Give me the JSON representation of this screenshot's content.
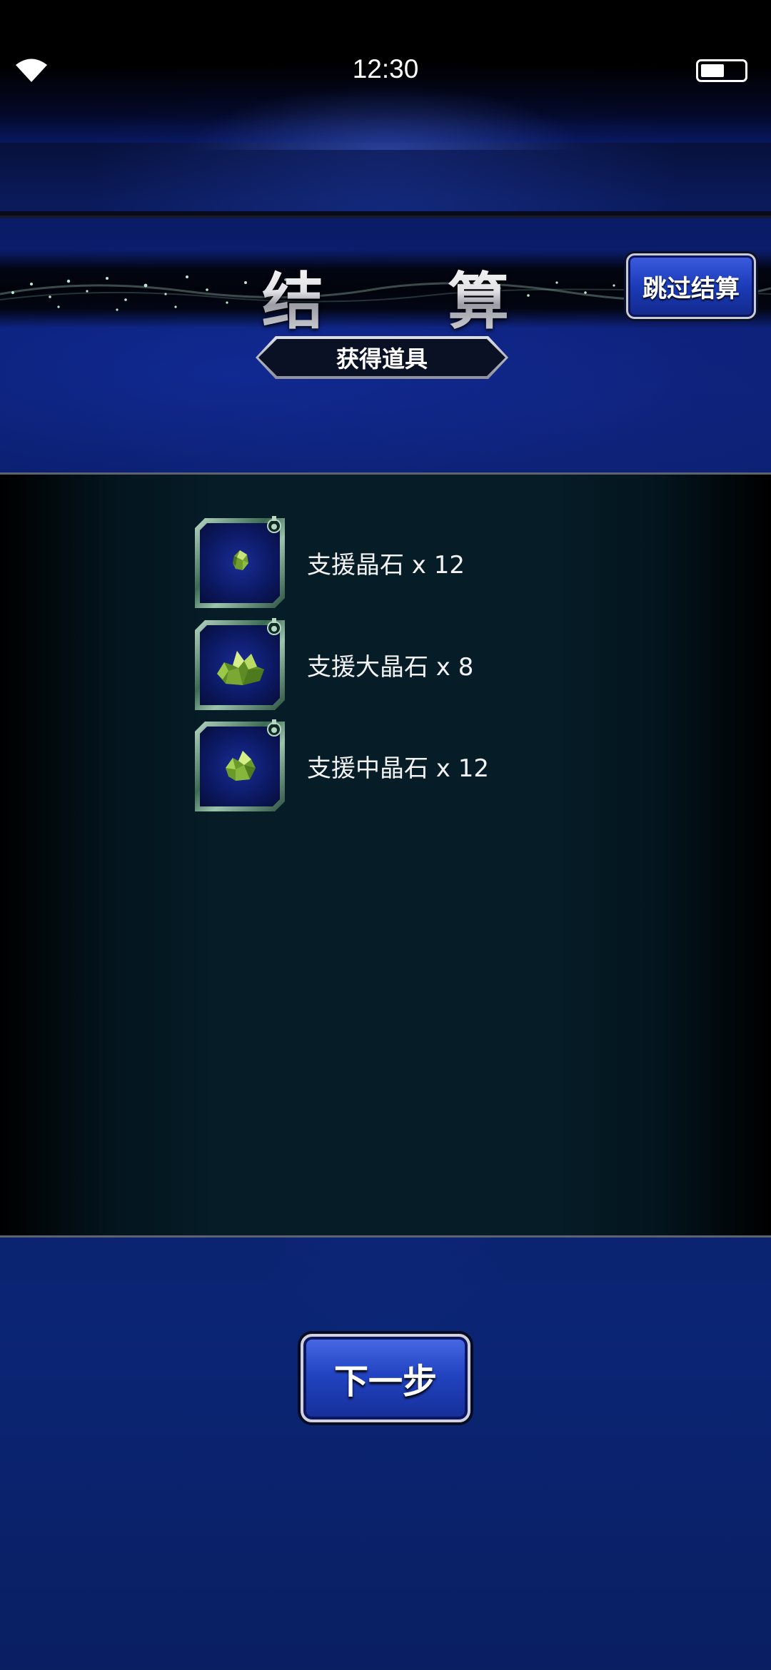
{
  "status_bar": {
    "time": "12:30",
    "wifi_icon": "wifi-icon",
    "battery_icon": "battery-icon",
    "battery_level": 0.55
  },
  "header": {
    "title": "结 算",
    "skip_button_label": "跳过结算",
    "subtitle": "获得道具"
  },
  "items": [
    {
      "label": "支援晶石 x 12",
      "icon": "small-green-crystal-icon"
    },
    {
      "label": "支援大晶石 x 8",
      "icon": "large-green-crystal-icon"
    },
    {
      "label": "支援中晶石 x 12",
      "icon": "medium-green-crystal-icon"
    }
  ],
  "footer": {
    "next_button_label": "下一步"
  },
  "colors": {
    "background_blue": "#0b2068",
    "button_blue": "#2244c2",
    "panel_dark": "#061d28",
    "crystal_green": "#7fb63a"
  }
}
